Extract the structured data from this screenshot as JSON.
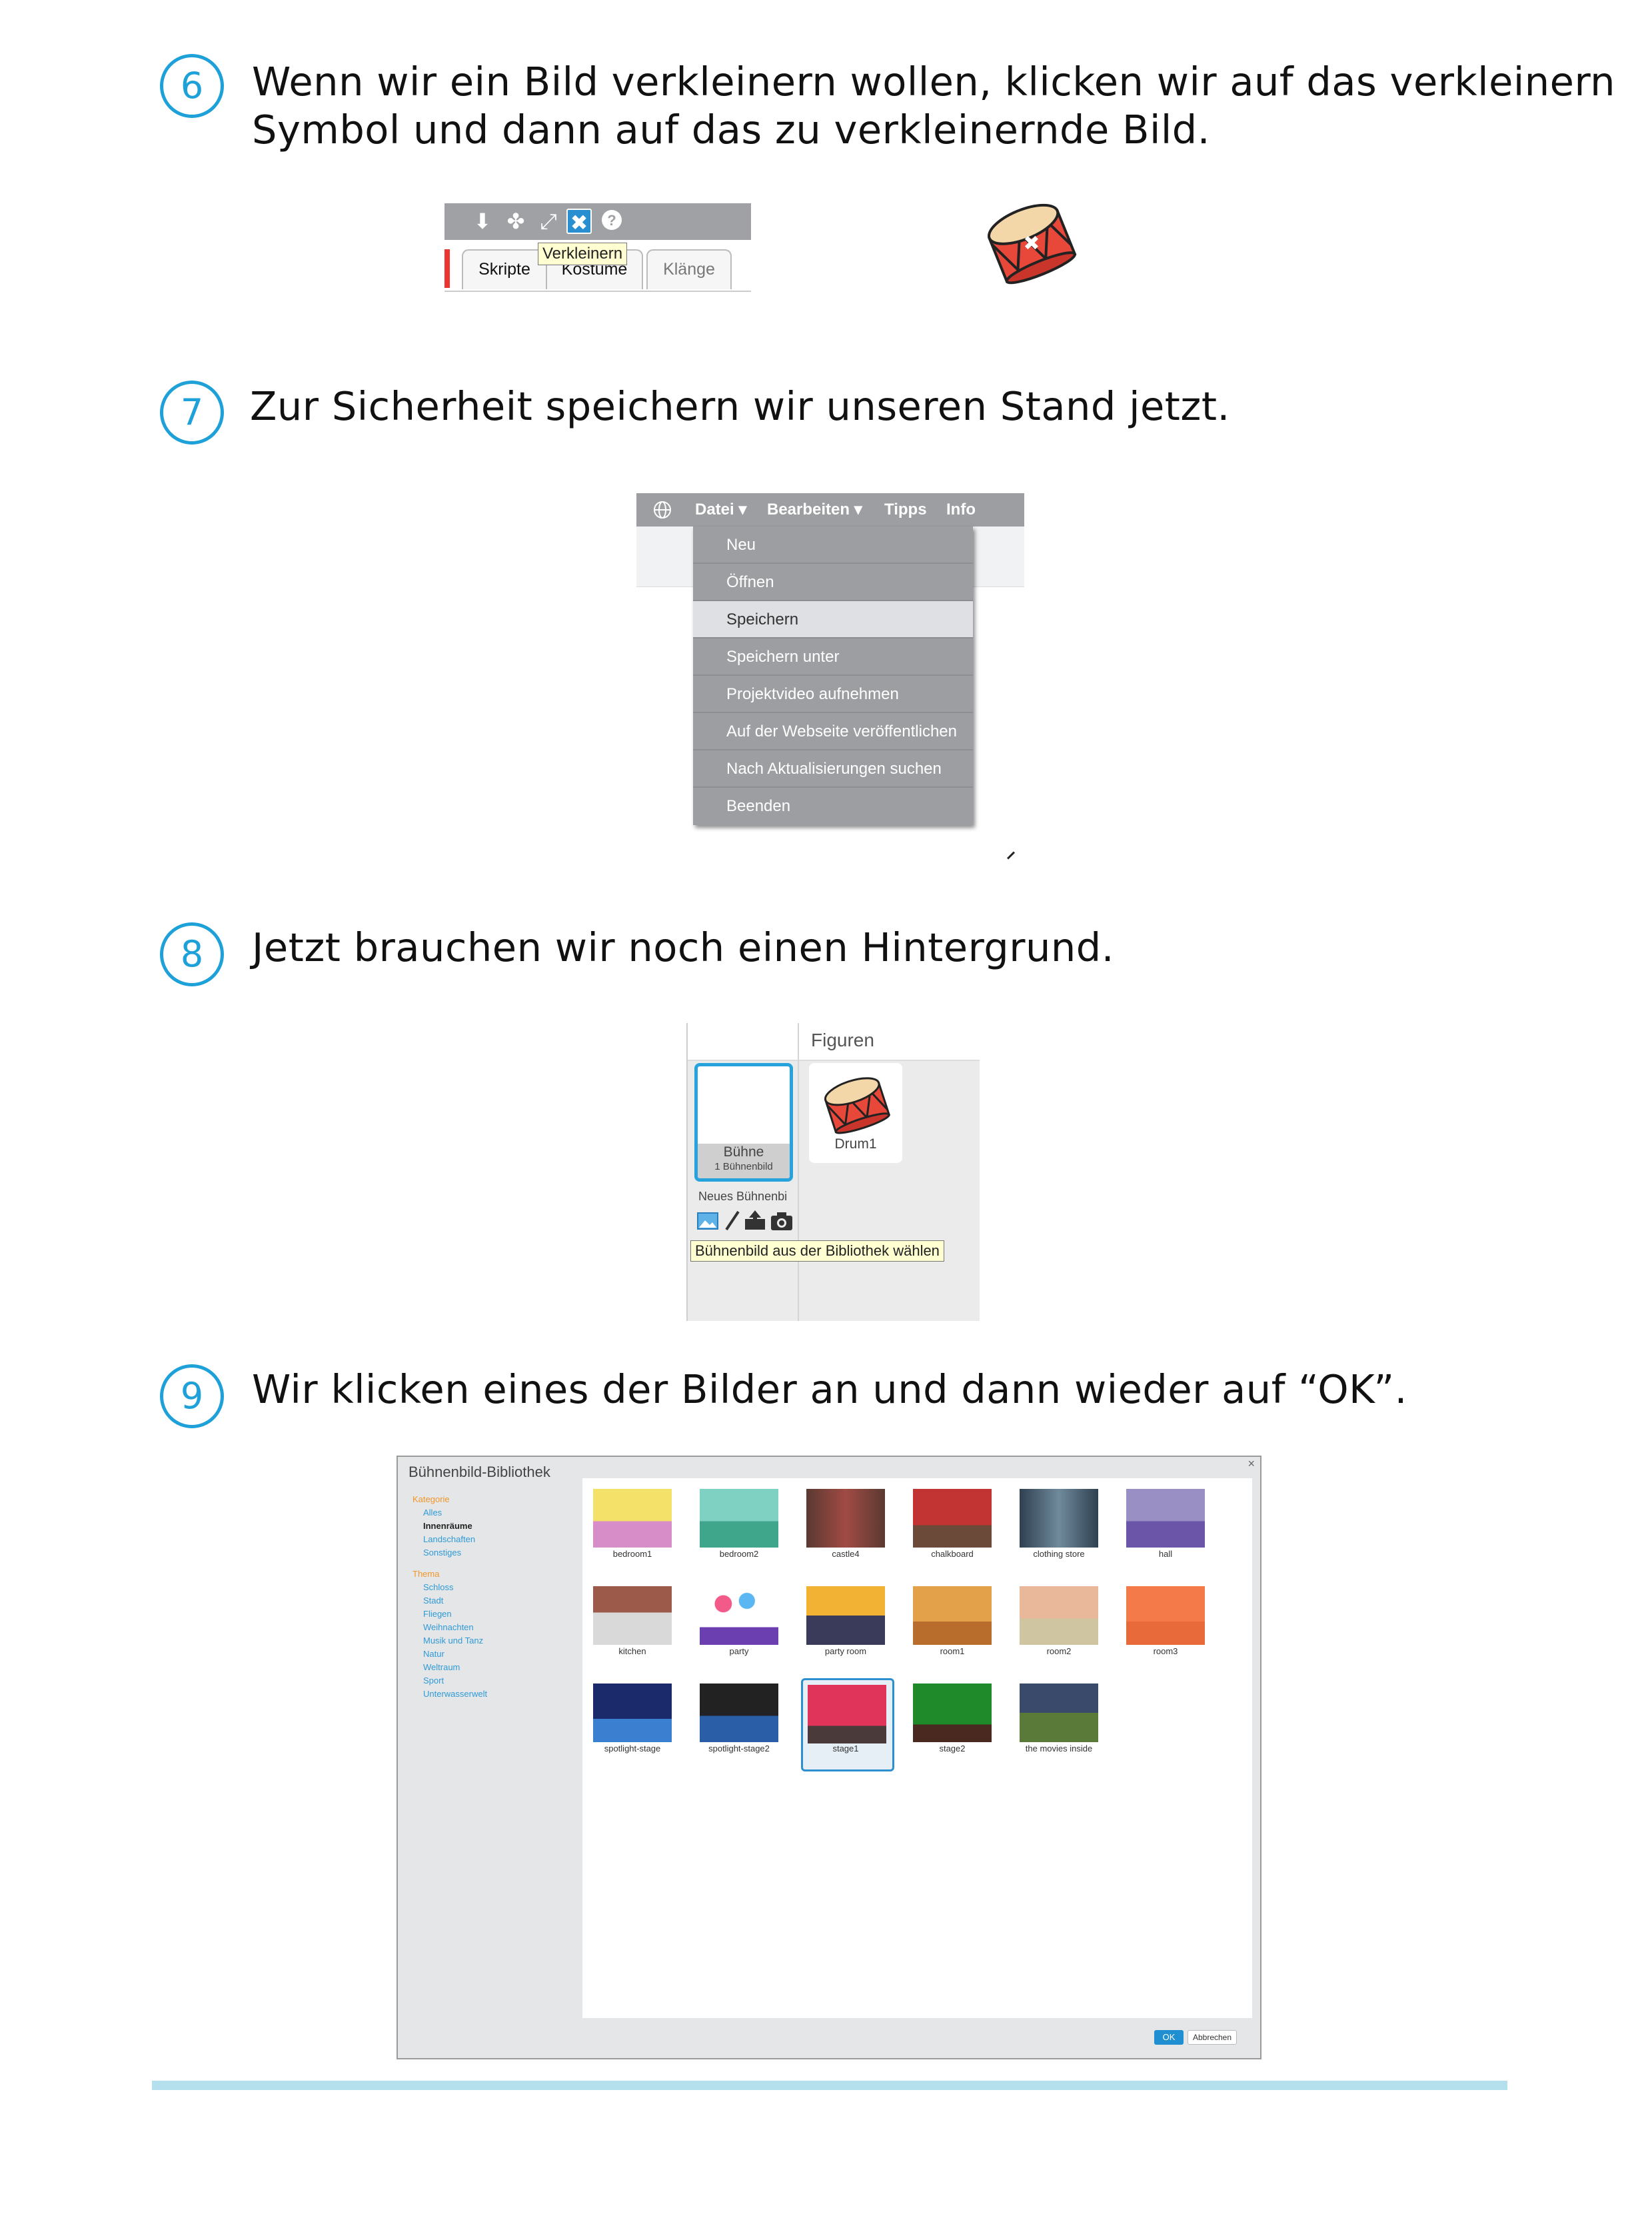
{
  "steps": [
    {
      "number": "6",
      "text_line1": "Wenn wir ein Bild verkleinern wollen, klicken wir auf das verkleinern",
      "text_line2": "Symbol und dann auf das zu verkleinernde Bild."
    },
    {
      "number": "7",
      "text_line1": "Zur Sicherheit speichern wir unseren Stand jetzt."
    },
    {
      "number": "8",
      "text_line1": "Jetzt brauchen wir noch einen Hintergrund."
    },
    {
      "number": "9",
      "text_line1": "Wir klicken eines der Bilder an und dann wieder auf “OK”."
    }
  ],
  "step6": {
    "toolbar_icons": [
      "stamp-icon",
      "cut-icon",
      "grow-icon",
      "shrink-icon",
      "help-icon"
    ],
    "tooltip": "Verkleinern",
    "tabs": [
      "Skripte",
      "Kostüme",
      "Klänge"
    ]
  },
  "step7": {
    "menubar": [
      "Datei ▾",
      "Bearbeiten ▾",
      "Tipps",
      "Info"
    ],
    "menu_items": [
      "Neu",
      "Öffnen",
      "Speichern",
      "Speichern unter",
      "Projektvideo aufnehmen",
      "Auf der Webseite veröffentlichen",
      "Nach Aktualisierungen suchen",
      "Beenden"
    ],
    "highlighted": "Speichern"
  },
  "step8": {
    "header": "Figuren",
    "stage_name": "Bühne",
    "stage_count": "1 Bühnenbild",
    "new_backdrop_label": "Neues Bühnenbi",
    "sprite_name": "Drum1",
    "tooltip": "Bühnenbild aus der Bibliothek wählen"
  },
  "step9": {
    "title": "Bühnenbild-Bibliothek",
    "close": "×",
    "category_head": "Kategorie",
    "categories": [
      "Alles",
      "Innenräume",
      "Landschaften",
      "Sonstiges"
    ],
    "selected_category": "Innenräume",
    "theme_head": "Thema",
    "themes": [
      "Schloss",
      "Stadt",
      "Fliegen",
      "Weihnachten",
      "Musik und Tanz",
      "Natur",
      "Weltraum",
      "Sport",
      "Unterwasserwelt"
    ],
    "backdrops": [
      "bedroom1",
      "bedroom2",
      "castle4",
      "chalkboard",
      "clothing store",
      "hall",
      "kitchen",
      "party",
      "party room",
      "room1",
      "room2",
      "room3",
      "spotlight-stage",
      "spotlight-stage2",
      "stage1",
      "stage2",
      "the movies inside"
    ],
    "selected_backdrop": "stage1",
    "ok": "OK",
    "cancel": "Abbrechen"
  },
  "colors": {
    "accent": "#1ea0d8",
    "rule": "#b4e0ee",
    "menu_grey": "#9c9ea1"
  }
}
